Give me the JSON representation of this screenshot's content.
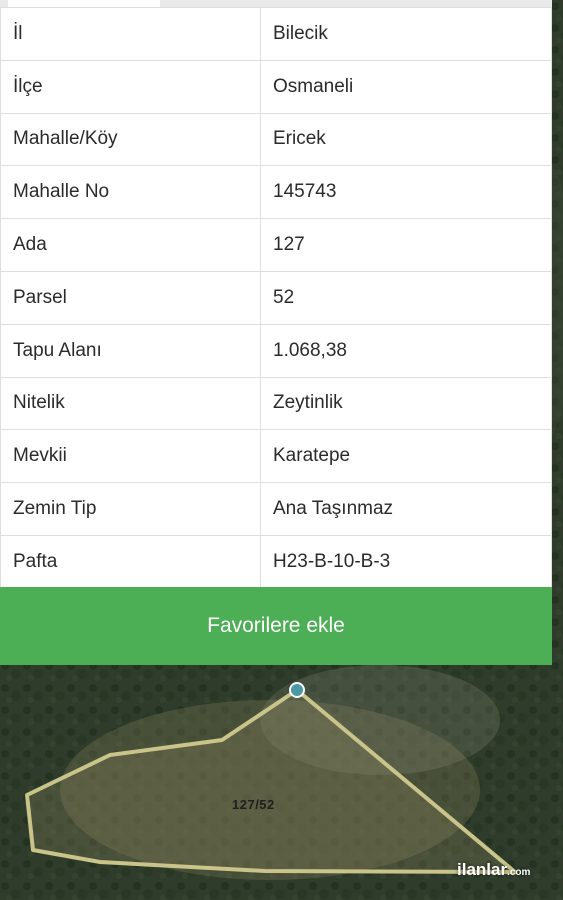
{
  "parcel_table": {
    "rows": [
      {
        "key": "İl",
        "value": "Bilecik"
      },
      {
        "key": "İlçe",
        "value": "Osmaneli"
      },
      {
        "key": "Mahalle/Köy",
        "value": "Ericek"
      },
      {
        "key": "Mahalle No",
        "value": "145743"
      },
      {
        "key": "Ada",
        "value": "127"
      },
      {
        "key": "Parsel",
        "value": "52"
      },
      {
        "key": "Tapu Alanı",
        "value": "1.068,38"
      },
      {
        "key": "Nitelik",
        "value": "Zeytinlik"
      },
      {
        "key": "Mevkii",
        "value": "Karatepe"
      },
      {
        "key": "Zemin Tip",
        "value": "Ana Taşınmaz"
      },
      {
        "key": "Pafta",
        "value": "H23-B-10-B-3"
      }
    ]
  },
  "favorite_button": {
    "label": "Favorilere ekle"
  },
  "map": {
    "parcel_label": "127/52"
  },
  "watermark": {
    "name": "ilanlar",
    "suffix": ".com"
  },
  "colors": {
    "accent_green": "#4cae55",
    "parcel_outline": "#c9c48a",
    "marker": "#4a9aa3"
  }
}
